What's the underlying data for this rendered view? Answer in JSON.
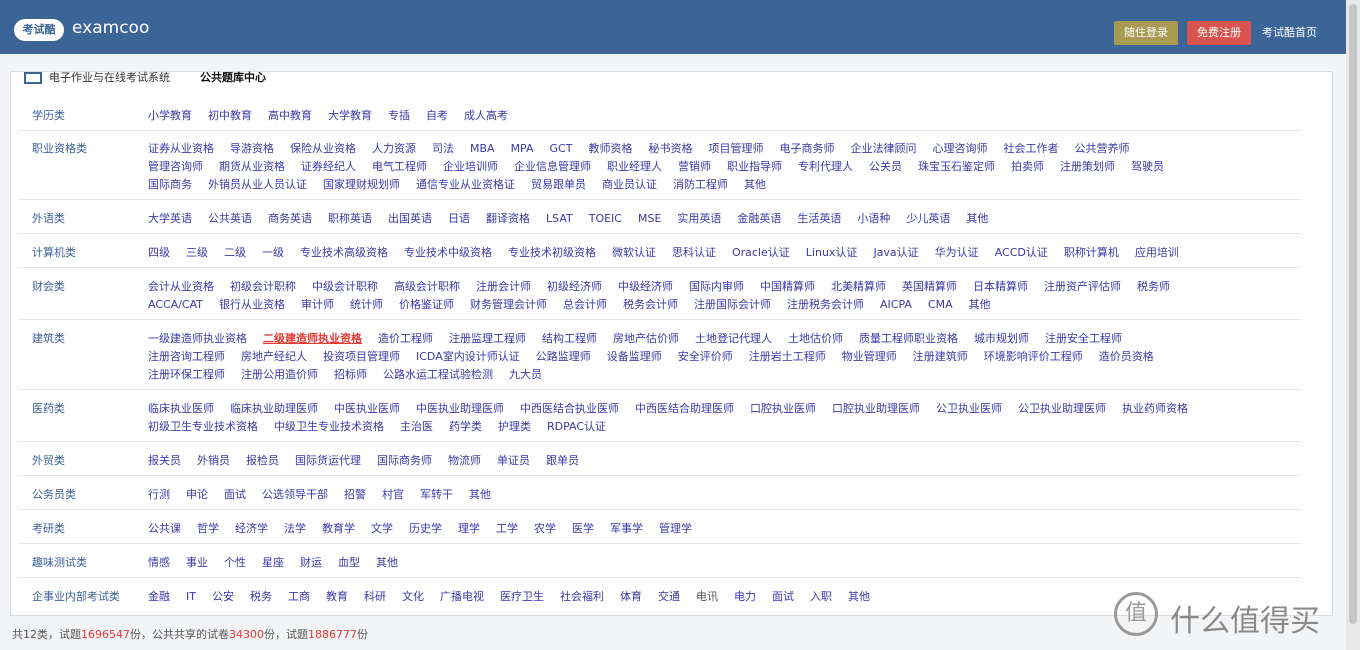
{
  "header": {
    "logo_text": "考试酷",
    "brand": "examcoo",
    "login_label": "随住登录",
    "register_label": "免费注册",
    "home_link": "考试酷首页"
  },
  "breadcrumb": {
    "system": "电子作业与在线考试系统",
    "current": "公共题库中心"
  },
  "categories": [
    {
      "label": "学历类",
      "lines": [
        [
          "小学教育",
          "初中教育",
          "高中教育",
          "大学教育",
          "专插",
          "自考",
          "成人高考"
        ]
      ]
    },
    {
      "label": "职业资格类",
      "lines": [
        [
          "证券从业资格",
          "导游资格",
          "保险从业资格",
          "人力资源",
          "司法",
          "MBA",
          "MPA",
          "GCT",
          "教师资格",
          "秘书资格",
          "项目管理师",
          "电子商务师",
          "企业法律顾问",
          "心理咨询师",
          "社会工作者",
          "公共营养师"
        ],
        [
          "管理咨询师",
          "期货从业资格",
          "证券经纪人",
          "电气工程师",
          "企业培训师",
          "企业信息管理师",
          "职业经理人",
          "营销师",
          "职业指导师",
          "专利代理人",
          "公关员",
          "珠宝玉石鉴定师",
          "拍卖师",
          "注册策划师",
          "驾驶员"
        ],
        [
          "国际商务",
          "外销员从业人员认证",
          "国家理财规划师",
          "通信专业从业资格证",
          "贸易跟单员",
          "商业员认证",
          "消防工程师",
          "其他"
        ]
      ]
    },
    {
      "label": "外语类",
      "lines": [
        [
          "大学英语",
          "公共英语",
          "商务英语",
          "职称英语",
          "出国英语",
          "日语",
          "翻译资格",
          "LSAT",
          "TOEIC",
          "MSE",
          "实用英语",
          "金融英语",
          "生活英语",
          "小语种",
          "少儿英语",
          "其他"
        ]
      ]
    },
    {
      "label": "计算机类",
      "lines": [
        [
          "四级",
          "三级",
          "二级",
          "一级",
          "专业技术高级资格",
          "专业技术中级资格",
          "专业技术初级资格",
          "微软认证",
          "思科认证",
          "Oracle认证",
          "Linux认证",
          "Java认证",
          "华为认证",
          "ACCD认证",
          "职称计算机",
          "应用培训"
        ]
      ]
    },
    {
      "label": "财会类",
      "lines": [
        [
          "会计从业资格",
          "初级会计职称",
          "中级会计职称",
          "高级会计职称",
          "注册会计师",
          "初级经济师",
          "中级经济师",
          "国际内审师",
          "中国精算师",
          "北美精算师",
          "英国精算师",
          "日本精算师",
          "注册资产评估师",
          "税务师"
        ],
        [
          "ACCA/CAT",
          "银行从业资格",
          "审计师",
          "统计师",
          "价格鉴证师",
          "财务管理会计师",
          "总会计师",
          "税务会计师",
          "注册国际会计师",
          "注册税务会计师",
          "AICPA",
          "CMA",
          "其他"
        ]
      ]
    },
    {
      "label": "建筑类",
      "lines": [
        [
          "一级建造师执业资格",
          "二级建造师执业资格",
          "造价工程师",
          "注册监理工程师",
          "结构工程师",
          "房地产估价师",
          "土地登记代理人",
          "土地估价师",
          "质量工程师职业资格",
          "城市规划师",
          "注册安全工程师"
        ],
        [
          "注册咨询工程师",
          "房地产经纪人",
          "投资项目管理师",
          "ICDA室内设计师认证",
          "公路监理师",
          "设备监理师",
          "安全评价师",
          "注册岩土工程师",
          "物业管理师",
          "注册建筑师",
          "环境影响评价工程师",
          "造价员资格"
        ],
        [
          "注册环保工程师",
          "注册公用造价师",
          "招标师",
          "公路水运工程试验检测",
          "九大员"
        ]
      ]
    },
    {
      "label": "医药类",
      "lines": [
        [
          "临床执业医师",
          "临床执业助理医师",
          "中医执业医师",
          "中医执业助理医师",
          "中西医结合执业医师",
          "中西医结合助理医师",
          "口腔执业医师",
          "口腔执业助理医师",
          "公卫执业医师",
          "公卫执业助理医师",
          "执业药师资格"
        ],
        [
          "初级卫生专业技术资格",
          "中级卫生专业技术资格",
          "主治医",
          "药学类",
          "护理类",
          "RDPAC认证"
        ]
      ]
    },
    {
      "label": "外贸类",
      "lines": [
        [
          "报关员",
          "外销员",
          "报检员",
          "国际货运代理",
          "国际商务师",
          "物流师",
          "单证员",
          "跟单员"
        ]
      ]
    },
    {
      "label": "公务员类",
      "lines": [
        [
          "行测",
          "申论",
          "面试",
          "公选领导干部",
          "招警",
          "村官",
          "军转干",
          "其他"
        ]
      ]
    },
    {
      "label": "考研类",
      "lines": [
        [
          "公共课",
          "哲学",
          "经济学",
          "法学",
          "教育学",
          "文学",
          "历史学",
          "理学",
          "工学",
          "农学",
          "医学",
          "军事学",
          "管理学"
        ]
      ]
    },
    {
      "label": "趣味测试类",
      "lines": [
        [
          "情感",
          "事业",
          "个性",
          "星座",
          "财运",
          "血型",
          "其他"
        ]
      ]
    },
    {
      "label": "企事业内部考试类",
      "lines": [
        [
          "金融",
          "IT",
          "公安",
          "税务",
          "工商",
          "教育",
          "科研",
          "文化",
          "广播电视",
          "医疗卫生",
          "社会福利",
          "体育",
          "交通",
          "电讯",
          "电力",
          "面试",
          "入职",
          "其他"
        ]
      ]
    }
  ],
  "footer": {
    "prefix": "共12类，试题",
    "count1": "1696547",
    "mid1": "份，公共共享的试卷",
    "count2": "34300",
    "mid2": "份，试题",
    "count3": "1886777",
    "suffix": "份"
  },
  "watermark": {
    "icon": "值",
    "text": "什么值得买"
  }
}
